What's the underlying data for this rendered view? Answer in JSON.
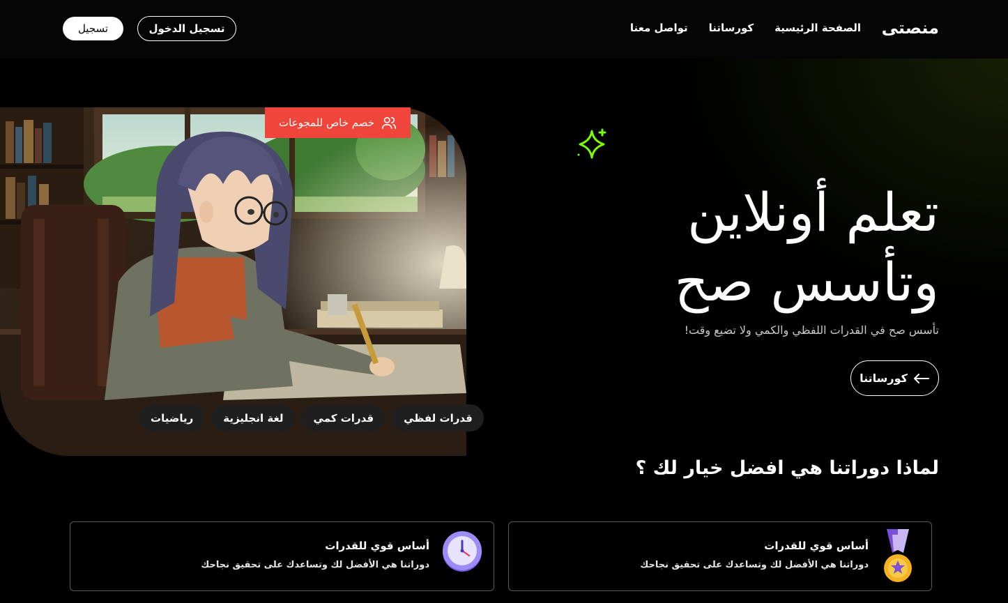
{
  "header": {
    "brand": "منصتى",
    "nav": [
      "الصفحة الرئيسية",
      "كورساتنا",
      "تواصل معنا"
    ],
    "login_label": "تسجيل الدخول",
    "signup_label": "تسجيل"
  },
  "hero": {
    "badge": "خصم خاص للمجوعات",
    "tags": [
      "قدرات لفظي",
      "قدرات كمي",
      "لغة انجليزية",
      "رياضيات"
    ],
    "title_line1": "تعلم أونلاين",
    "title_line2": "وتأسس صح",
    "subtitle": "تأسس صح في القدرات اللفظي والكمي ولا تضيع وقت!",
    "cta_label": "كورساتنا"
  },
  "why": {
    "title": "لماذا دوراتنا هي افضل خيار لك ؟",
    "cards": [
      {
        "title": "أساس قوي للقدرات",
        "desc": "دوراتنا هي الأفضل لك وتساعدك على تحقيق نجاحك",
        "icon": "medal-icon"
      },
      {
        "title": "أساس قوي للقدرات",
        "desc": "دوراتنا هي الأفضل لك وتساعدك على تحقيق نجاحك",
        "icon": "clock-icon"
      }
    ]
  },
  "colors": {
    "accent_green": "#7CFC00",
    "badge_red": "#f0453a",
    "tag_bg": "#1f1f1f"
  }
}
